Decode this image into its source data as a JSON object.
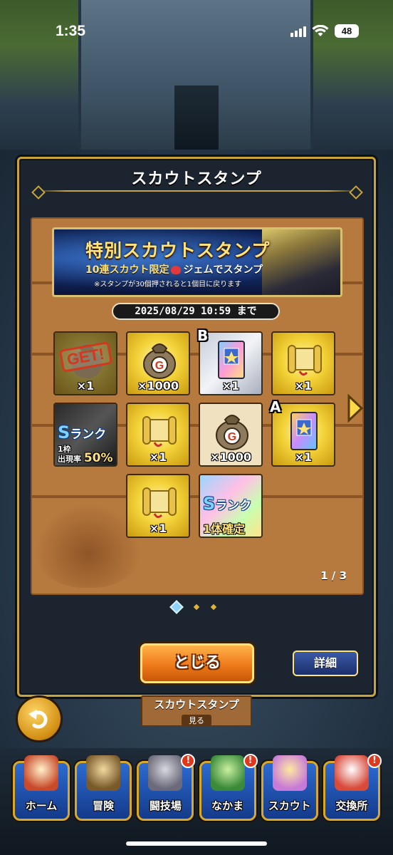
{
  "status_bar": {
    "time": "1:35",
    "battery": "48"
  },
  "dialog": {
    "title": "スカウトスタンプ",
    "banner": {
      "title": "特別スカウトスタンプ",
      "subtitle_a": "10連スカウト限定",
      "subtitle_b": "ジェムでスタンプ",
      "note": "※スタンプが30個押されると1個目に戻ります"
    },
    "deadline": "2025/08/29 10:59 まで",
    "stamps": [
      {
        "qty": "×1",
        "claimed": true,
        "get_label": "GET!",
        "icon": "pouch-icon"
      },
      {
        "qty": "×1000",
        "claimed": false,
        "icon": "gold-bag-icon"
      },
      {
        "qty": "×1",
        "claimed": false,
        "rank": "B",
        "icon": "rank-book-icon"
      },
      {
        "qty": "×1",
        "claimed": false,
        "icon": "scroll-icon"
      },
      {
        "qty": "",
        "claimed": false,
        "icon": "s-rank-ticket-icon",
        "rank_label": "ランク",
        "rate_line": "1枠",
        "rate_sub": "出現率",
        "rate": "50%"
      },
      {
        "qty": "×1",
        "claimed": false,
        "icon": "scroll-icon"
      },
      {
        "qty": "×1000",
        "claimed": false,
        "icon": "gold-bag-icon"
      },
      {
        "qty": "×1",
        "claimed": false,
        "rank": "A",
        "icon": "rank-book-icon"
      },
      {
        "qty": "×1",
        "claimed": false,
        "icon": "scroll-icon"
      },
      {
        "qty": "",
        "claimed": false,
        "icon": "s-rank-confirm-icon",
        "rank_label": "ランク",
        "confirm": "1体確定"
      }
    ],
    "page_indicator": "1 / 3",
    "close_label": "とじる",
    "detail_label": "詳細"
  },
  "background_sign": {
    "title": "スカウトスタンプ",
    "sub": "見る"
  },
  "nav": {
    "items": [
      {
        "label": "ホーム",
        "alert": false
      },
      {
        "label": "冒険",
        "alert": false
      },
      {
        "label": "闘技場",
        "alert": true
      },
      {
        "label": "なかま",
        "alert": true
      },
      {
        "label": "スカウト",
        "alert": false
      },
      {
        "label": "交換所",
        "alert": true
      }
    ],
    "alert_mark": "!"
  },
  "colors": {
    "frame_gold": "#c9a43a",
    "close_orange": "#ef7a1a",
    "detail_blue": "#1c2f6a",
    "nav_blue": "#2c6bd1"
  }
}
